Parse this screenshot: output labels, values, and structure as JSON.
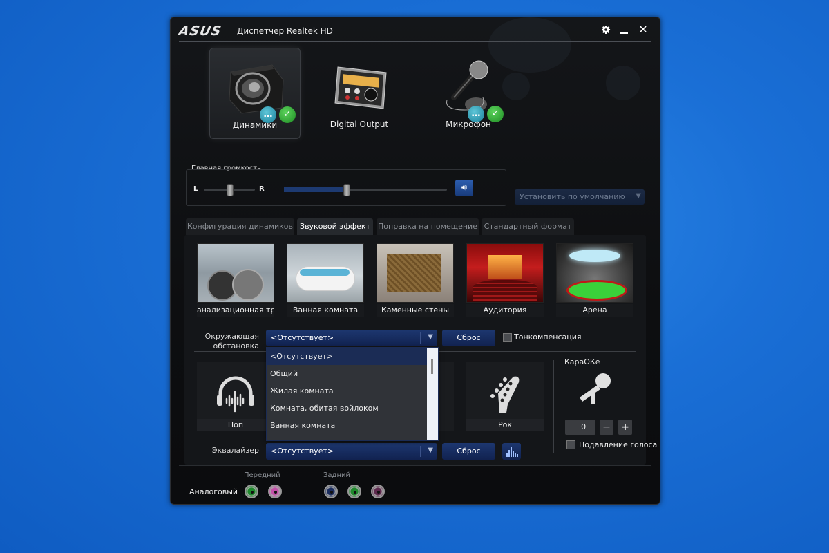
{
  "window": {
    "logo": "ASUS",
    "title": "Диспетчер Realtek HD",
    "controls": {
      "settings": "gear-icon",
      "minimize": "–",
      "close": "✕"
    }
  },
  "devices": [
    {
      "label": "Динамики",
      "active": true,
      "badges": [
        "chat",
        "ok"
      ]
    },
    {
      "label": "Digital Output",
      "active": false,
      "badges": []
    },
    {
      "label": "Микрофон",
      "active": false,
      "badges": [
        "chat",
        "ok"
      ]
    }
  ],
  "volume": {
    "title": "Главная громкость",
    "balance_left": "L",
    "balance_right": "R",
    "balance_value": 0.5,
    "level_value": 0.38,
    "mute_icon": "speaker-icon"
  },
  "default_device": {
    "label": "Установить по умолчанию"
  },
  "tabs": [
    {
      "label": "Конфигурация динамиков",
      "active": false
    },
    {
      "label": "Звуковой эффект",
      "active": true
    },
    {
      "label": "Поправка на помещение",
      "active": false
    },
    {
      "label": "Стандартный формат",
      "active": false
    }
  ],
  "environments": [
    {
      "label": "Канализационная труба",
      "visible_label": "анализационная труб"
    },
    {
      "label": "Ванная комната"
    },
    {
      "label": "Каменные стены"
    },
    {
      "label": "Аудитория"
    },
    {
      "label": "Арена"
    }
  ],
  "environment_row": {
    "label_line1": "Окружающая",
    "label_line2": "обстановка",
    "value": "<Отсутствует>",
    "reset": "Сброс",
    "loudness_label": "Тонкомпенсация",
    "loudness_checked": false
  },
  "environment_dropdown": {
    "options": [
      "<Отсутствует>",
      "Общий",
      "Жилая комната",
      "Комната, обитая войлоком",
      "Ванная комната"
    ],
    "selected_index": 0
  },
  "genres": [
    {
      "label": "Поп"
    },
    {
      "label": ""
    },
    {
      "label": ""
    },
    {
      "label": "Рок"
    }
  ],
  "equalizer_row": {
    "label": "Эквалайзер",
    "value": "<Отсутствует>",
    "reset": "Сброс"
  },
  "karaoke": {
    "title": "КараОКе",
    "value": "+0",
    "minus": "−",
    "plus": "+",
    "voice_cancel_label": "Подавление голоса",
    "voice_cancel_checked": false
  },
  "footer": {
    "analog_label": "Аналоговый",
    "front_label": "Передний",
    "rear_label": "Задний",
    "front_jacks": [
      "#1e8a2c",
      "#c44fa8"
    ],
    "rear_jacks": [
      "#1b2d5e",
      "#1e8a2c",
      "#5e2a4e"
    ]
  }
}
